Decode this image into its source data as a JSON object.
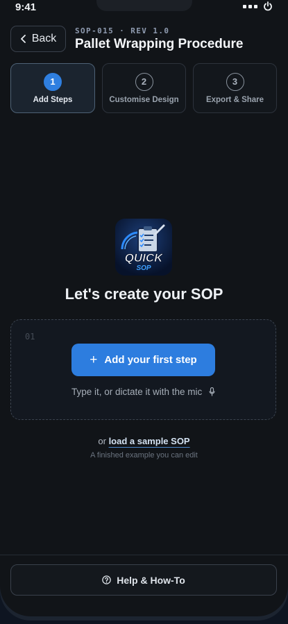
{
  "status_bar": {
    "time": "9:41"
  },
  "header": {
    "back_label": "Back",
    "doc_code": "SOP-015 · REV 1.0",
    "title": "Pallet Wrapping Procedure"
  },
  "steps": [
    {
      "number": "1",
      "label": "Add Steps",
      "active": true
    },
    {
      "number": "2",
      "label": "Customise Design",
      "active": false
    },
    {
      "number": "3",
      "label": "Export & Share",
      "active": false
    }
  ],
  "logo": {
    "line1": "QUICK",
    "line2": "SOP"
  },
  "main": {
    "heading": "Let's create your SOP",
    "step_number": "01",
    "add_step_label": "Add your first step",
    "hint": "Type it, or dictate it with the mic",
    "sample_prefix": "or",
    "sample_link": "load a sample SOP",
    "sample_sub": "A finished example you can edit"
  },
  "footer": {
    "help_label": "Help & How-To"
  },
  "colors": {
    "accent": "#2d7ddf",
    "background": "#111418"
  },
  "icons": [
    "power-icon",
    "chevron-left-icon",
    "plus-icon",
    "mic-icon",
    "help-circle-icon"
  ]
}
